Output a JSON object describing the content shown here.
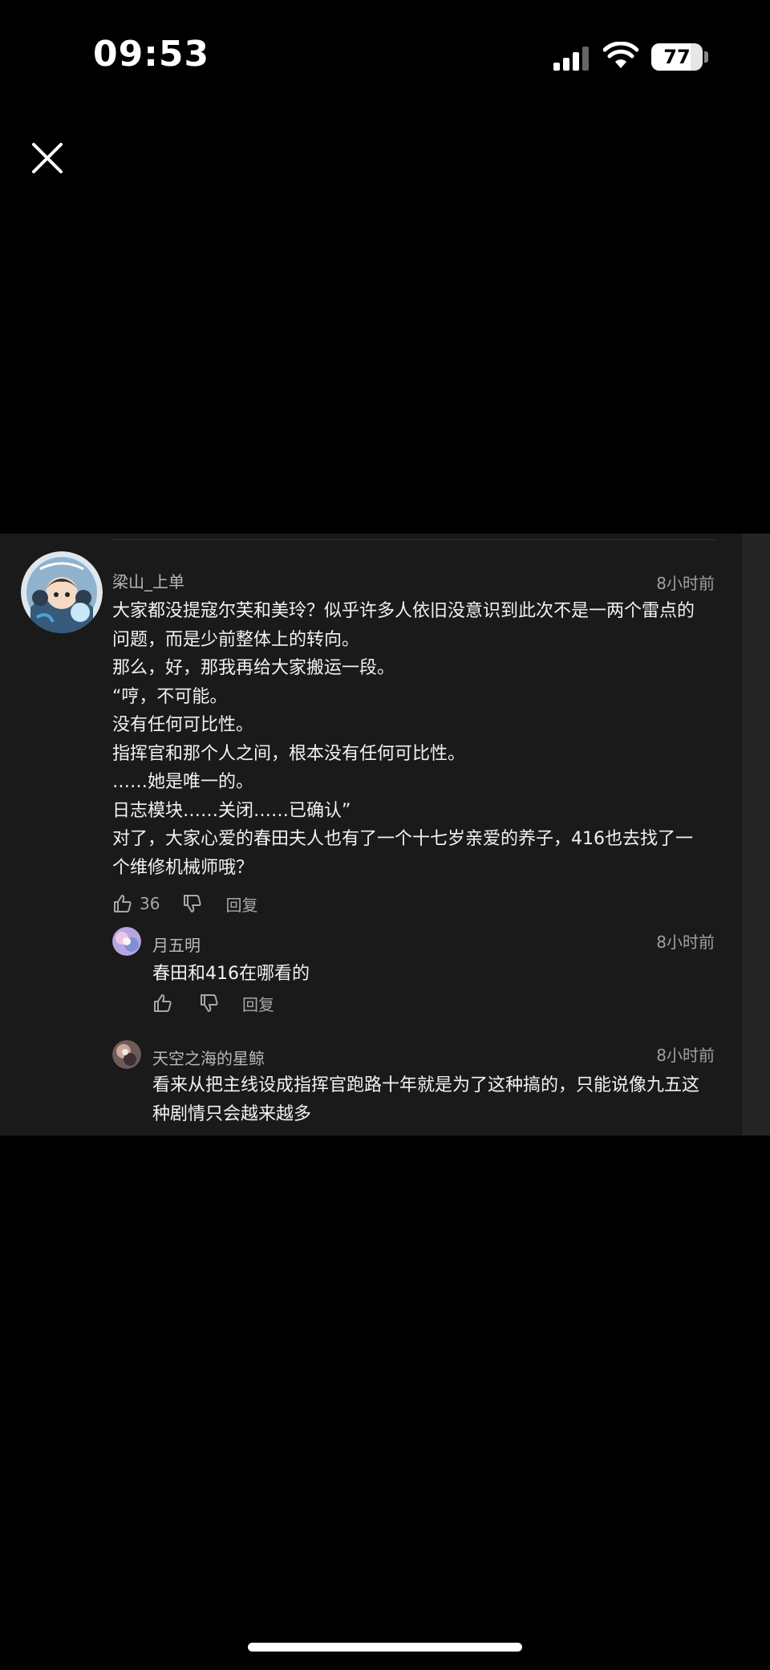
{
  "status_bar": {
    "time": "09:53",
    "battery_percent": "77",
    "battery_level": 0.77,
    "icons": [
      "cellular-signal-icon",
      "wifi-icon",
      "battery-icon"
    ]
  },
  "close_icon": "close-icon",
  "comments": {
    "main": {
      "username": "梁山_上单",
      "time": "8小时前",
      "lines": [
        "大家都没提寇尔芙和美玲？似乎许多人依旧没意识到此次不是一两个雷点的",
        "问题，而是少前整体上的转向。",
        "那么，好，那我再给大家搬运一段。",
        "“哼，不可能。",
        "没有任何可比性。",
        "指挥官和那个人之间，根本没有任何可比性。",
        "……她是唯一的。",
        "日志模块……关闭……已确认”",
        "对了，大家心爱的春田夫人也有了一个十七岁亲爱的养子，416也去找了一",
        "个维修机械师哦？"
      ],
      "likes": "36",
      "reply_label": "回复"
    },
    "replies": [
      {
        "username": "月五明",
        "time": "8小时前",
        "lines": [
          "春田和416在哪看的"
        ],
        "reply_label": "回复"
      },
      {
        "username": "天空之海的星鲸",
        "time": "8小时前",
        "lines": [
          "看来从把主线设成指挥官跑路十年就是为了这种搞的，只能说像九五这",
          "种剧情只会越来越多"
        ]
      }
    ]
  },
  "colors": {
    "page_bg": "#000000",
    "panel_bg": "#1a1a1a",
    "text_primary": "#f2f2f2",
    "text_secondary": "#a8a8a8"
  }
}
